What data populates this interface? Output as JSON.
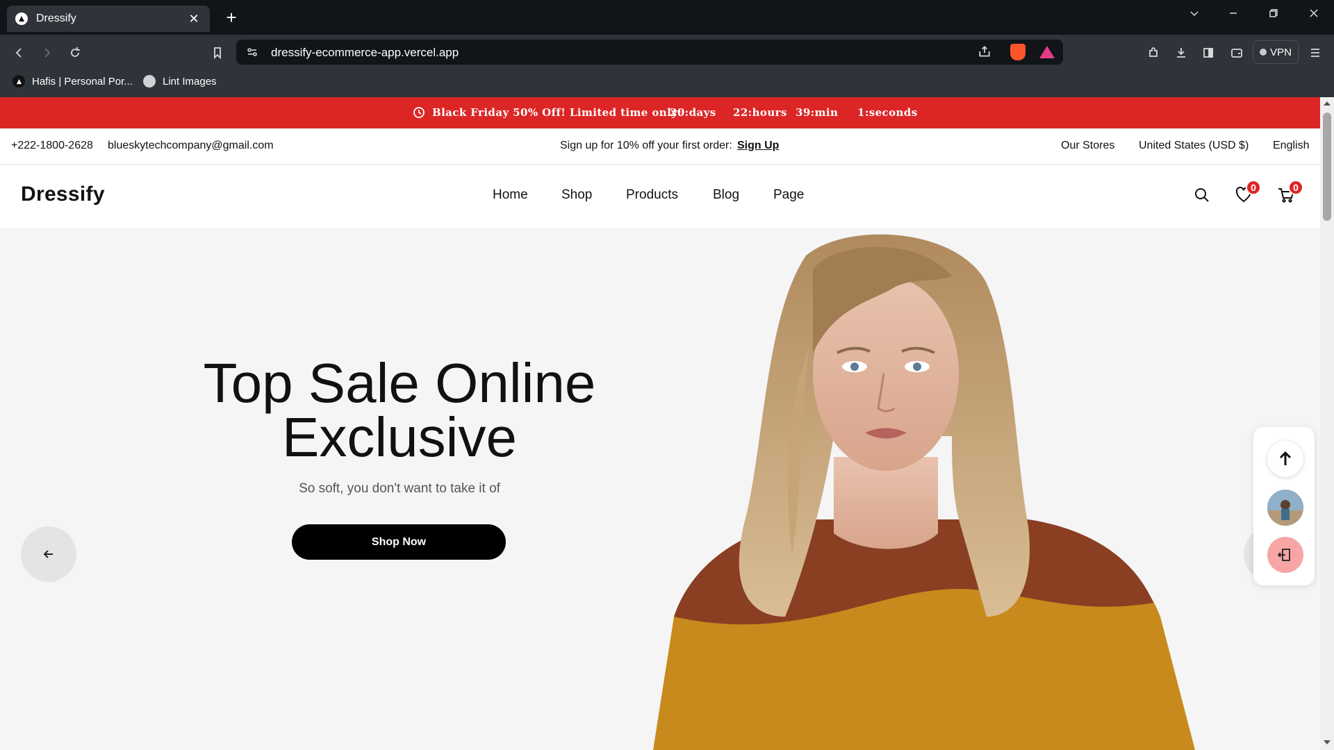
{
  "browser": {
    "tab_title": "Dressify",
    "url": "dressify-ecommerce-app.vercel.app",
    "vpn_label": "VPN",
    "bookmarks": [
      "Hafis | Personal Por...",
      "Lint Images"
    ]
  },
  "promo": {
    "text": "Black Friday 50% Off! Limited time only:",
    "days": "20:days",
    "hours": "22:hours",
    "minutes": "39:min",
    "seconds": "1:seconds",
    "color": "#dc2626"
  },
  "infobar": {
    "phone": "+222-1800-2628",
    "email": "blueskytechcompany@gmail.com",
    "signup_text": "Sign up for 10% off your first order:",
    "signup_link": "Sign Up",
    "stores": "Our Stores",
    "currency": "United States (USD $)",
    "language": "English"
  },
  "header": {
    "logo": "Dressify",
    "menu": [
      "Home",
      "Shop",
      "Products",
      "Blog",
      "Page"
    ],
    "wishlist_count": "0",
    "cart_count": "0"
  },
  "hero": {
    "title_line1": "Top Sale Online",
    "title_line2": "Exclusive",
    "subtitle": "So soft, you don't want to take it of",
    "button": "Shop Now"
  },
  "icons": [
    "search-icon",
    "heart-icon",
    "cart-icon",
    "arrow-left-icon",
    "arrow-right-icon",
    "arrow-up-icon",
    "logout-icon",
    "clock-icon"
  ]
}
